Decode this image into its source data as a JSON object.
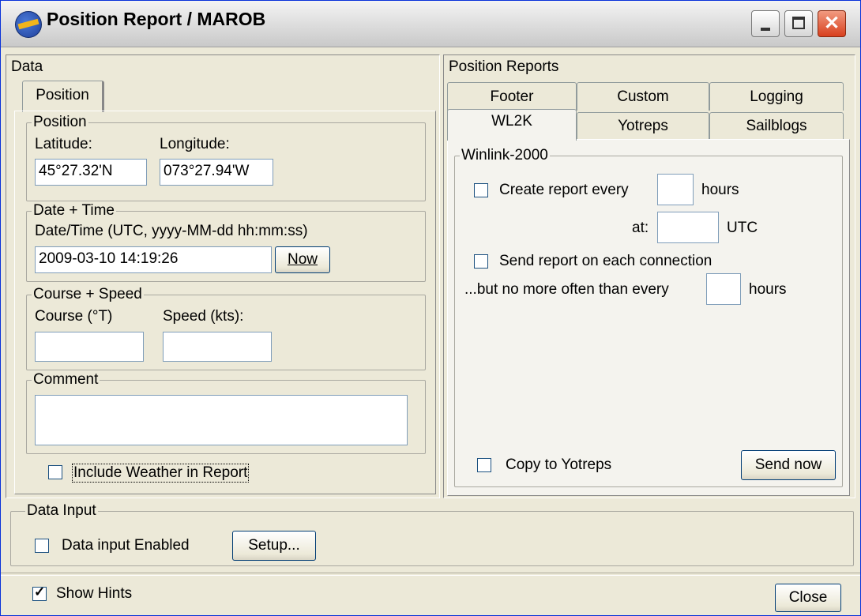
{
  "window": {
    "title": "Position Report / MAROB",
    "minimize_glyph": "",
    "maximize_glyph": "",
    "close_glyph": "✕"
  },
  "data_panel": {
    "title": "Data",
    "tab_label": "Position",
    "position_group": {
      "title": "Position",
      "latitude_label": "Latitude:",
      "latitude_value": "45°27.32'N",
      "longitude_label": "Longitude:",
      "longitude_value": "073°27.94'W"
    },
    "datetime_group": {
      "title": "Date + Time",
      "label": "Date/Time (UTC, yyyy-MM-dd hh:mm:ss)",
      "value": "2009-03-10 14:19:26",
      "now_button": "Now"
    },
    "course_group": {
      "title": "Course + Speed",
      "course_label": "Course (°T)",
      "course_value": "",
      "speed_label": "Speed (kts):",
      "speed_value": ""
    },
    "comment_group": {
      "title": "Comment",
      "value": ""
    },
    "include_weather": {
      "label": "Include Weather in Report",
      "checked": false
    }
  },
  "reports_panel": {
    "title": "Position Reports",
    "tabs_row1": [
      "Footer",
      "Custom",
      "Logging"
    ],
    "tabs_row2": [
      "WL2K",
      "Yotreps",
      "Sailblogs"
    ],
    "active_tab": "WL2K",
    "winlink": {
      "title": "Winlink-2000",
      "create_report_label": "Create report every",
      "create_report_checked": false,
      "hours_value": "",
      "hours_label": "hours",
      "at_label": "at:",
      "at_value": "",
      "utc_label": "UTC",
      "send_each_label": "Send report on each connection",
      "send_each_checked": false,
      "no_more_label": "...but no more often than every",
      "no_more_value": "",
      "no_more_hours_label": "hours",
      "copy_yotreps_label": "Copy to Yotreps",
      "copy_yotreps_checked": false,
      "send_now_button": "Send now"
    }
  },
  "data_input": {
    "title": "Data Input",
    "enabled_label": "Data input Enabled",
    "enabled_checked": false,
    "setup_button": "Setup..."
  },
  "footer": {
    "show_hints_label": "Show Hints",
    "show_hints_checked": true,
    "check_mark": "✓",
    "close_button": "Close"
  }
}
